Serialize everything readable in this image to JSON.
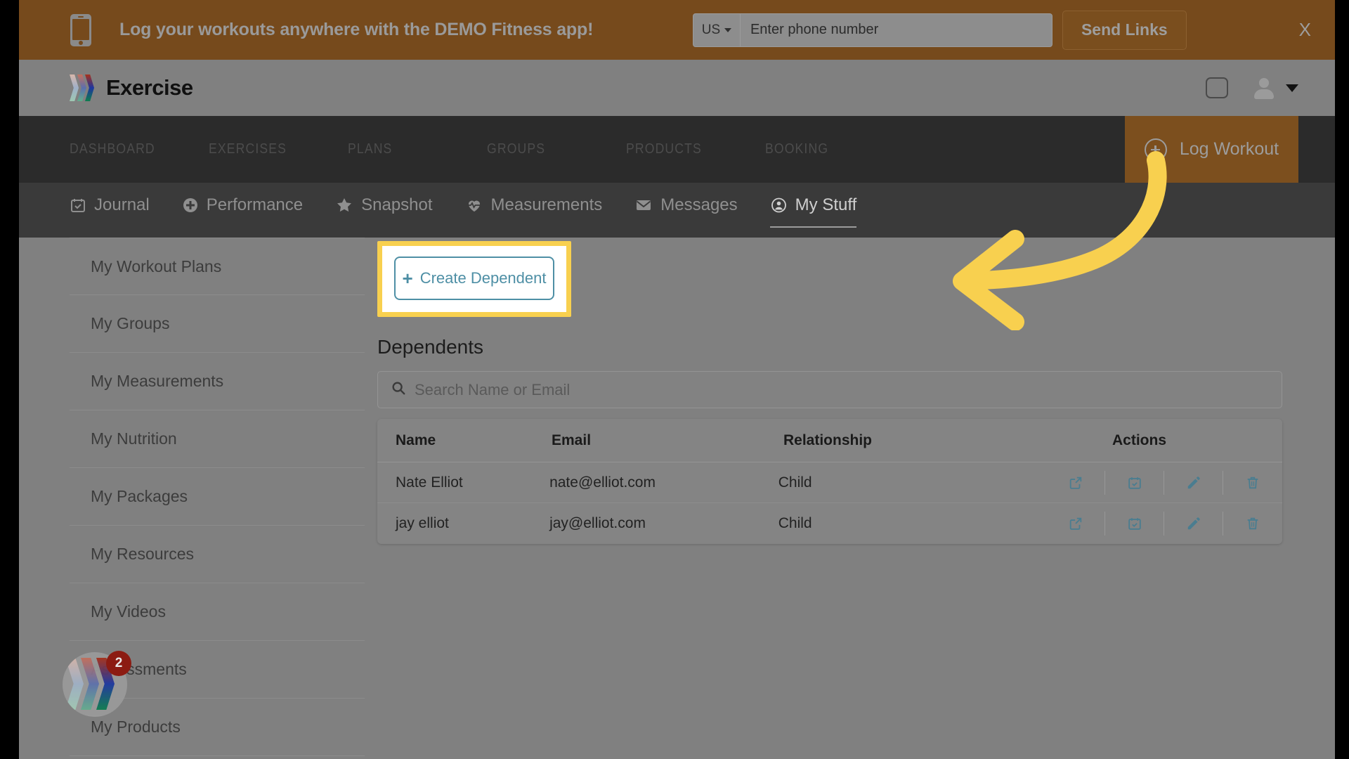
{
  "promo": {
    "phone_icon": "mobile-phone-icon",
    "message": "Log your workouts anywhere with the DEMO Fitness app!",
    "country_code": "US",
    "phone_placeholder": "Enter phone number",
    "phone_value": "",
    "send_label": "Send Links",
    "close_label": "X",
    "bg_color": "#764a1c"
  },
  "brand": {
    "title": "Exercise",
    "logo_icon": "chevron-logo-icon",
    "square_icon": "rounded-square-icon",
    "avatar_icon": "user-avatar-icon",
    "caret_icon": "chevron-down-icon"
  },
  "main_nav": {
    "items": [
      {
        "label": "DASHBOARD"
      },
      {
        "label": "EXERCISES"
      },
      {
        "label": "PLANS"
      },
      {
        "label": "GROUPS"
      },
      {
        "label": "PRODUCTS"
      },
      {
        "label": "BOOKING"
      }
    ],
    "cta": {
      "label": "Log Workout",
      "icon": "plus-circle-icon",
      "bg_color": "#7c4f1e"
    }
  },
  "sub_nav": {
    "items": [
      {
        "label": "Journal",
        "icon": "calendar-check-icon",
        "active": false
      },
      {
        "label": "Performance",
        "icon": "plus-circle-icon",
        "active": false
      },
      {
        "label": "Snapshot",
        "icon": "star-icon",
        "active": false
      },
      {
        "label": "Measurements",
        "icon": "heartbeat-icon",
        "active": false
      },
      {
        "label": "Messages",
        "icon": "envelope-icon",
        "active": false
      },
      {
        "label": "My Stuff",
        "icon": "user-circle-icon",
        "active": true
      }
    ]
  },
  "sidebar": {
    "items": [
      {
        "label": "My Workout Plans"
      },
      {
        "label": "My Groups"
      },
      {
        "label": "My Measurements"
      },
      {
        "label": "My Nutrition"
      },
      {
        "label": "My Packages"
      },
      {
        "label": "My Resources"
      },
      {
        "label": "My Videos"
      },
      {
        "label": "Assessments"
      },
      {
        "label": "My Products"
      }
    ]
  },
  "float_widget": {
    "icon": "chevron-logo-icon",
    "badge_count": "2",
    "badge_color": "#8c1b12"
  },
  "content": {
    "create_button": {
      "label": "Create Dependent",
      "plus": "+",
      "accent_color": "#4e8fa5"
    },
    "highlight_color": "#f8d04f",
    "arrow_color": "#f8d04f",
    "section_title": "Dependents",
    "search": {
      "placeholder": "Search Name or Email",
      "value": "",
      "icon": "search-icon"
    },
    "table": {
      "columns": [
        "Name",
        "Email",
        "Relationship",
        "Actions"
      ],
      "rows": [
        {
          "name": "Nate Elliot",
          "email": "nate@elliot.com",
          "relationship": "Child",
          "actions": [
            "external-link-icon",
            "calendar-check-icon",
            "pencil-icon",
            "trash-icon"
          ]
        },
        {
          "name": "jay elliot",
          "email": "jay@elliot.com",
          "relationship": "Child",
          "actions": [
            "external-link-icon",
            "calendar-check-icon",
            "pencil-icon",
            "trash-icon"
          ]
        }
      ]
    }
  }
}
